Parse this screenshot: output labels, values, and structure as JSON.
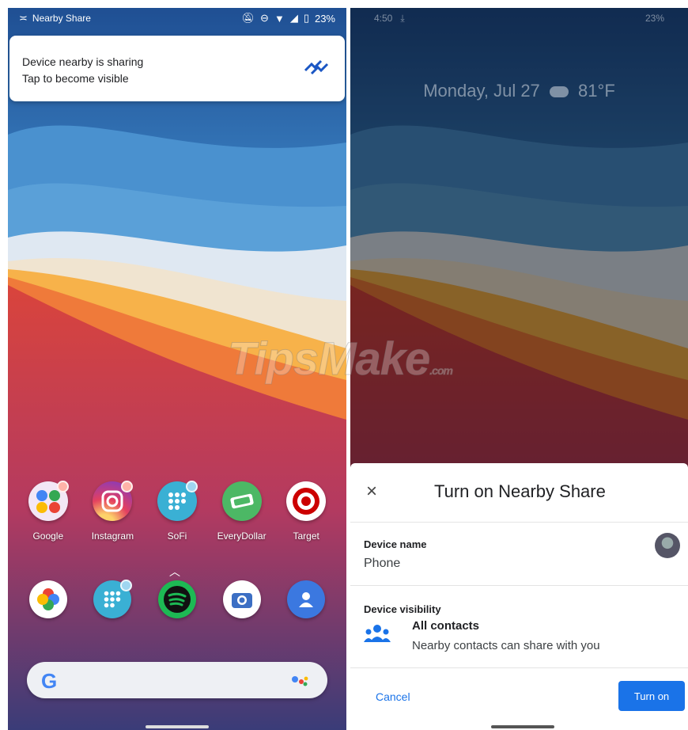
{
  "left": {
    "status_bar": {
      "app": "Nearby Share",
      "battery": "23%"
    },
    "notification": {
      "title": "Device nearby is sharing",
      "subtitle": "Tap to become visible"
    },
    "apps": [
      {
        "label": "Google",
        "icon": "google-folder-icon"
      },
      {
        "label": "Instagram",
        "icon": "instagram-icon"
      },
      {
        "label": "SoFi",
        "icon": "sofi-icon"
      },
      {
        "label": "EveryDollar",
        "icon": "everydollar-icon"
      },
      {
        "label": "Target",
        "icon": "target-icon"
      }
    ],
    "dock": [
      "pinwheel-icon",
      "grid-icon",
      "spotify-icon",
      "camera-icon",
      "contacts-icon"
    ],
    "search_logo": "G"
  },
  "right": {
    "status_bar": {
      "time": "4:50",
      "battery": "23%"
    },
    "lockscreen": {
      "date": "Monday, Jul 27",
      "temp": "81°F"
    },
    "sheet": {
      "title": "Turn on Nearby Share",
      "close_label": "×",
      "device_name_label": "Device name",
      "device_name_value": "Phone",
      "visibility_label": "Device visibility",
      "visibility_option": "All contacts",
      "visibility_desc": "Nearby contacts can share with you",
      "cancel_label": "Cancel",
      "turn_on_label": "Turn on"
    }
  },
  "watermark": {
    "text": "TipsMake",
    "suffix": ".com"
  },
  "colors": {
    "accent": "#1a73e8",
    "sky": "#3f80c0",
    "orange": "#e8583a"
  }
}
